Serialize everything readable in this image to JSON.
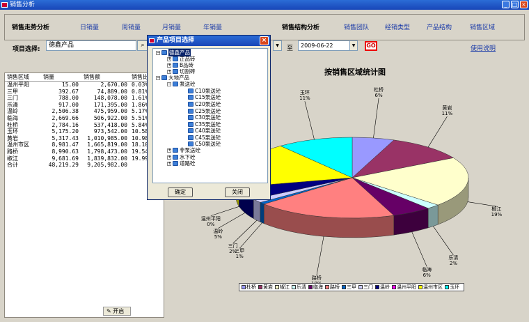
{
  "window": {
    "title": "销售分析"
  },
  "nav": {
    "trend_label": "销售走势分析",
    "trend_links": [
      "日销量",
      "周销量",
      "月销量",
      "年销量"
    ],
    "structure_label": "销售结构分析",
    "structure_links": [
      "销售团队",
      "经销类型",
      "产品结构",
      "销售区域"
    ]
  },
  "filter": {
    "label": "项目选择:",
    "value": "德鑫产品",
    "to_label": "至",
    "end_date": "2009-06-22",
    "go_label": "GO",
    "help_label": "使用说明"
  },
  "table": {
    "headers": [
      "销售区域",
      "销量",
      "销售额",
      "销售比"
    ],
    "rows": [
      [
        "温州平阳",
        "15.00",
        "2,670.00",
        "0.03%"
      ],
      [
        "三甲",
        "392.67",
        "74,889.00",
        "0.81%"
      ],
      [
        "三门",
        "788.00",
        "148,078.00",
        "1.61%"
      ],
      [
        "乐清",
        "917.00",
        "171,395.00",
        "1.86%"
      ],
      [
        "温岭",
        "2,506.38",
        "475,959.00",
        "5.17%"
      ],
      [
        "临海",
        "2,669.66",
        "506,922.00",
        "5.51%"
      ],
      [
        "杜桥",
        "2,784.16",
        "537,418.00",
        "5.84%"
      ],
      [
        "玉环",
        "5,175.20",
        "973,542.00",
        "10.58%"
      ],
      [
        "黄岩",
        "5,317.43",
        "1,010,985.00",
        "10.98%"
      ],
      [
        "温州市区",
        "8,981.47",
        "1,665,819.00",
        "18.10%"
      ],
      [
        "路桥",
        "8,990.63",
        "1,798,473.00",
        "19.54%"
      ],
      [
        "椒江",
        "9,681.69",
        "1,839,832.00",
        "19.99%"
      ],
      [
        "合计",
        "48,219.29",
        "9,205,982.00",
        ""
      ]
    ]
  },
  "taskbar": {
    "start_label": "开启"
  },
  "chart_data": {
    "type": "pie",
    "title": "按销售区域统计图",
    "slices": [
      {
        "name": "杜桥",
        "percent": "6%",
        "color": "#9999ff"
      },
      {
        "name": "黄岩",
        "percent": "11%",
        "color": "#993366"
      },
      {
        "name": "椒江",
        "percent": "19%",
        "color": "#ffffcc"
      },
      {
        "name": "乐清",
        "percent": "2%",
        "color": "#ccffff"
      },
      {
        "name": "临海",
        "percent": "6%",
        "color": "#660066"
      },
      {
        "name": "路桥",
        "percent": "18%",
        "color": "#ff8080"
      },
      {
        "name": "三甲",
        "percent": "1%",
        "color": "#0066cc"
      },
      {
        "name": "三门",
        "percent": "2%",
        "color": "#ccccff"
      },
      {
        "name": "温岭",
        "percent": "5%",
        "color": "#000080"
      },
      {
        "name": "温州平阳",
        "percent": "0%",
        "color": "#ff00ff"
      },
      {
        "name": "温州市区",
        "percent": "",
        "color": "#ffff00"
      },
      {
        "name": "玉环",
        "percent": "11%",
        "color": "#00ffff"
      }
    ],
    "values": [
      5.84,
      10.98,
      19.99,
      1.86,
      5.51,
      19.54,
      0.81,
      1.61,
      5.17,
      0.03,
      18.1,
      10.58
    ]
  },
  "dialog": {
    "title": "产品项目选择",
    "ok_label": "确定",
    "close_label": "关闭",
    "tree": [
      "德鑫产品",
      "正品砖",
      "B品砖",
      "切割砖",
      "大地产品",
      "泵送砼",
      "C10泵送砼",
      "C15泵送砼",
      "C20泵送砼",
      "C25泵送砼",
      "C30泵送砼",
      "C35泵送砼",
      "C40泵送砼",
      "C45泵送砼",
      "C50泵送砼",
      "非泵送砼",
      "水下砼",
      "道路砼"
    ]
  }
}
